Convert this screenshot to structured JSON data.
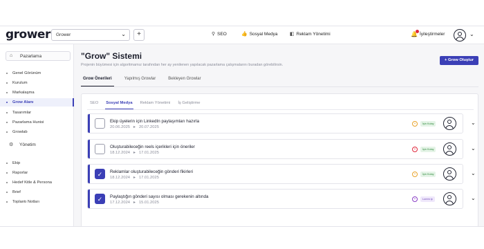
{
  "header": {
    "logo": "grower",
    "workspace_select": "Grower",
    "add_label": "+",
    "nav": [
      {
        "label": "SEO",
        "icon": "chart-icon"
      },
      {
        "label": "Sosyal Medya",
        "icon": "thumbs-up-icon"
      },
      {
        "label": "Reklam Yönetimi",
        "icon": "megaphone-icon"
      }
    ],
    "notifications": "İyileştirmeler"
  },
  "sidebar": {
    "section1": "Pazarlama",
    "items1": [
      "Genel Görünüm",
      "Kurulum",
      "Markalaşma",
      "Grow Alanı",
      "Tasarımlar",
      "Pazarlama Hunisi",
      "Growlab"
    ],
    "active_item": "Grow Alanı",
    "section2": "Yönetim",
    "items2": [
      "Ekip",
      "Raporlar",
      "Hedef Kitle & Persona",
      "Brief",
      "Toplantı Notları"
    ]
  },
  "main": {
    "title": "\"Grow\" Sistemi",
    "subtitle": "Projenin büyümesi için algoritmamız tarafından her ay yenilenen yapılacak pazarlama çalışmalarını buradan görebilirsin.",
    "create_button": "+ Grow Oluştur",
    "tabs": [
      "Grow Önerileri",
      "Yapılmış Growlar",
      "Bekleyen Growlar"
    ],
    "active_tab": 0,
    "subtabs": [
      "SEO",
      "Sosyal Medya",
      "Reklam Yönetimi",
      "İş Geliştirme"
    ],
    "active_subtab": 1,
    "tasks": [
      {
        "title": "Ekip üyelerin için LinkedIn paylaşımları hazırla",
        "start": "20.06.2025",
        "end": "20.07.2025",
        "checked": false,
        "status": "İşin Kolay",
        "status_color": "#2f8a3c",
        "status_bg": "#e5f4e7",
        "priority_color": "#e8a32a"
      },
      {
        "title": "Oluşturabileceğin reels içerikleri için öneriler",
        "start": "18.12.2024",
        "end": "17.01.2025",
        "checked": false,
        "status": "İşin Kolay",
        "status_color": "#2f8a3c",
        "status_bg": "#e5f4e7",
        "priority_color": "#e0283c"
      },
      {
        "title": "Reklamlar oluşturabileceğin gönderi fikirleri",
        "start": "18.12.2024",
        "end": "17.01.2025",
        "checked": true,
        "status": "İşin Kolay",
        "status_color": "#2f8a3c",
        "status_bg": "#e5f4e7",
        "priority_color": "#e8a32a"
      },
      {
        "title": "Paylaştığın gönderi sayısı olması gerekenin altında",
        "start": "17.12.2024",
        "end": "15.01.2025",
        "checked": true,
        "status": "Lorem ip",
        "status_color": "#6a3fb6",
        "status_bg": "#efe8fb",
        "priority_color": "#8a3fc6"
      }
    ]
  }
}
